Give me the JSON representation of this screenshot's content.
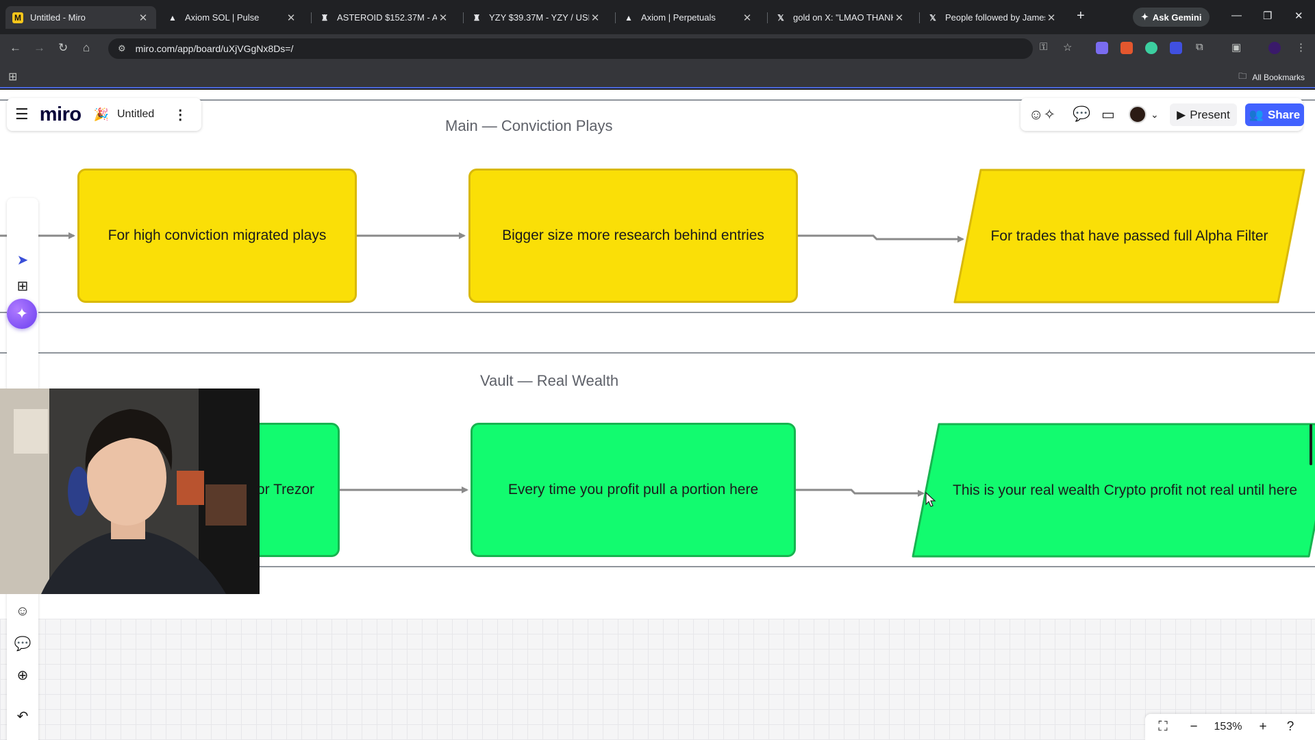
{
  "browser": {
    "tabs": [
      {
        "title": "Untitled - Miro",
        "favicon": "miro-favicon"
      },
      {
        "title": "Axiom SOL | Pulse",
        "favicon": "axiom-favicon"
      },
      {
        "title": "ASTEROID $152.37M - Aster",
        "favicon": "mask-favicon"
      },
      {
        "title": "YZY $39.37M - YZY / USDC o",
        "favicon": "mask-favicon"
      },
      {
        "title": "Axiom | Perpetuals",
        "favicon": "axiom-favicon"
      },
      {
        "title": "gold on X: \"LMAO THANK W",
        "favicon": "x-favicon"
      },
      {
        "title": "People followed by James W",
        "favicon": "x-favicon"
      }
    ],
    "ask_gemini_label": "Ask Gemini",
    "url": "miro.com/app/board/uXjVGgNx8Ds=/",
    "all_bookmarks_label": "All Bookmarks"
  },
  "miro": {
    "logo_text": "miro",
    "board_name": "Untitled",
    "present_label": "Present",
    "share_label": "Share",
    "zoom_level": "153%"
  },
  "flow": {
    "main_frame_title": "Main — Conviction Plays",
    "main_nodes": [
      "For high conviction migrated plays",
      "Bigger size more research behind entries",
      "For trades that have passed full Alpha Filter"
    ],
    "vault_frame_title": "Vault — Real Wealth",
    "vault_nodes": [
      "or Trezor",
      "Every time you profit pull a portion here",
      "This is your real wealth Crypto profit not real until here"
    ]
  },
  "colors": {
    "yellow_node": "#fadf07",
    "green_node": "#12fb6f",
    "share_button": "#4262ff",
    "ai_button": "#7b4cf5"
  }
}
